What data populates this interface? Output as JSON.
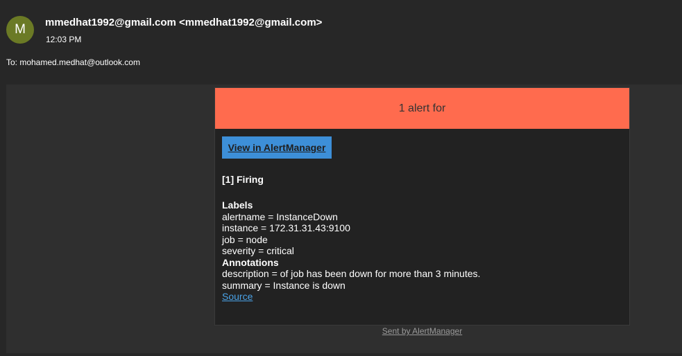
{
  "header": {
    "avatar_letter": "M",
    "sender": "mmedhat1992@gmail.com <mmedhat1992@gmail.com>",
    "time": "12:03 PM",
    "to": "To: mohamed.medhat@outlook.com"
  },
  "email": {
    "banner_text": "1 alert for",
    "banner_color": "#ff6b4e",
    "button_label": "View in AlertManager",
    "button_color": "#3d8fd8",
    "firing_title": "[1] Firing",
    "labels_heading": "Labels",
    "labels": [
      "alertname = InstanceDown",
      "instance = 172.31.31.43:9100",
      "job = node",
      "severity = critical"
    ],
    "annotations_heading": "Annotations",
    "annotations": [
      "description = of job has been down for more than 3 minutes.",
      "summary = Instance is down"
    ],
    "source_link": "Source",
    "footer": "Sent by AlertManager"
  }
}
